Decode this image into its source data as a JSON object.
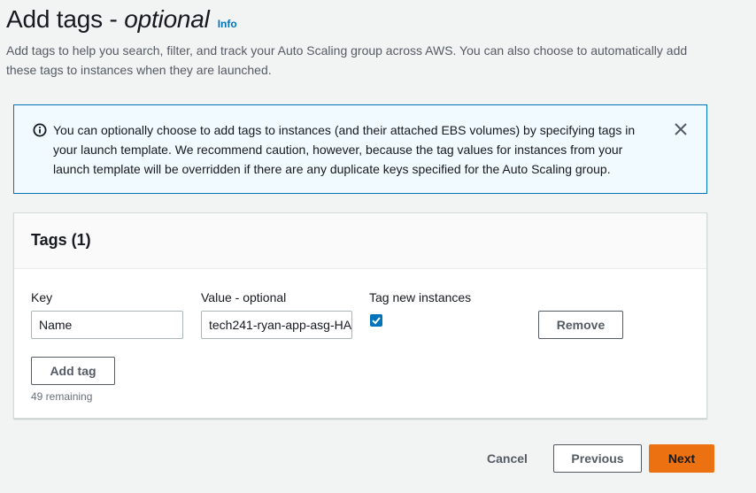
{
  "header": {
    "title_main": "Add tags - ",
    "title_italic": "optional",
    "info_link": "Info",
    "description": "Add tags to help you search, filter, and track your Auto Scaling group across AWS. You can also choose to automatically add these tags to instances when they are launched."
  },
  "alert": {
    "icon": "info-circle-icon",
    "text": "You can optionally choose to add tags to instances (and their attached EBS volumes) by specifying tags in your launch template. We recommend caution, however, because the tag values for instances from your launch template will be overridden if there are any duplicate keys specified for the Auto Scaling group.",
    "close_icon": "close-icon"
  },
  "tags": {
    "title": "Tags (1)",
    "columns": {
      "key": "Key",
      "value": "Value - optional",
      "tag_new_instances": "Tag new instances"
    },
    "rows": [
      {
        "key": "Name",
        "value": "tech241-ryan-app-asg-HA",
        "tag_new_instances": true,
        "remove_label": "Remove"
      }
    ],
    "add_tag_label": "Add tag",
    "remaining": "49 remaining"
  },
  "footer": {
    "cancel_label": "Cancel",
    "previous_label": "Previous",
    "next_label": "Next"
  },
  "colors": {
    "accent": "#0073bb",
    "primary_button": "#ec7211",
    "alert_background": "#f1faff"
  }
}
